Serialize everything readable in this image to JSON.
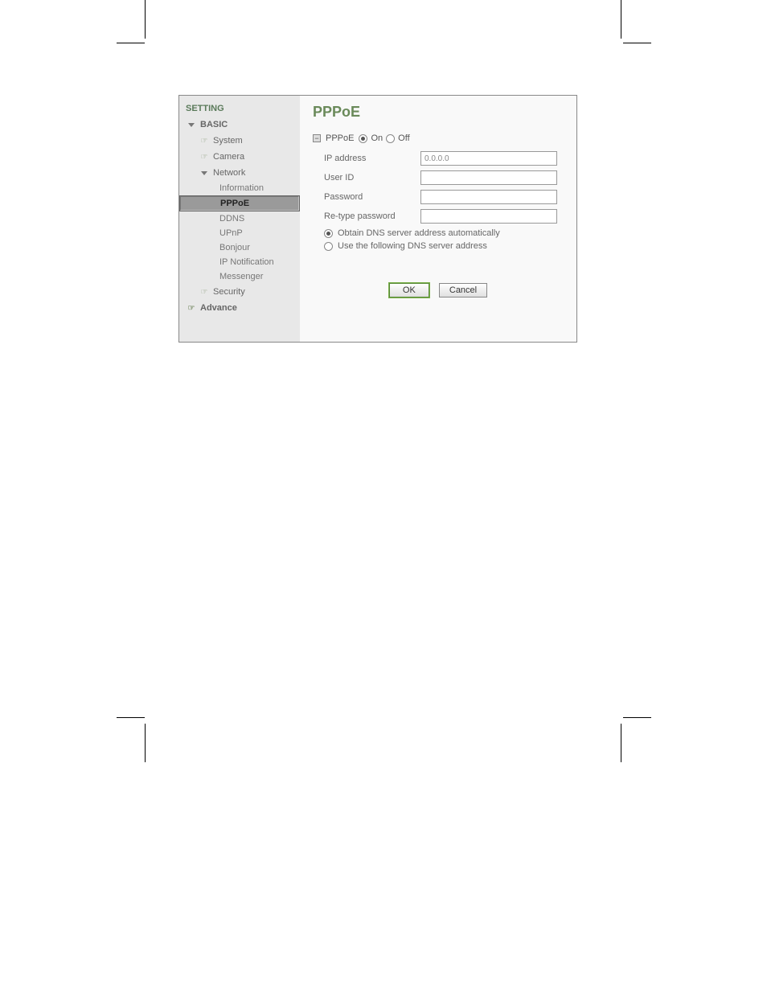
{
  "sidebar": {
    "header": "SETTING",
    "items": [
      {
        "label": "BASIC",
        "level": 1,
        "icon": "arrow-down"
      },
      {
        "label": "System",
        "level": 2,
        "icon": "hand"
      },
      {
        "label": "Camera",
        "level": 2,
        "icon": "hand"
      },
      {
        "label": "Network",
        "level": 2,
        "icon": "arrow-down"
      },
      {
        "label": "Information",
        "level": 3
      },
      {
        "label": "PPPoE",
        "level": 3,
        "selected": true
      },
      {
        "label": "DDNS",
        "level": 3
      },
      {
        "label": "UPnP",
        "level": 3
      },
      {
        "label": "Bonjour",
        "level": 3
      },
      {
        "label": "IP Notification",
        "level": 3
      },
      {
        "label": "Messenger",
        "level": 3
      },
      {
        "label": "Security",
        "level": 2,
        "icon": "hand"
      },
      {
        "label": "Advance",
        "level": 1,
        "icon": "hand"
      }
    ]
  },
  "page": {
    "title": "PPPoE",
    "section_label": "PPPoE",
    "on_label": "On",
    "off_label": "Off",
    "fields": {
      "ip_label": "IP address",
      "ip_value": "0.0.0.0",
      "userid_label": "User ID",
      "userid_value": "",
      "password_label": "Password",
      "password_value": "",
      "retype_label": "Re-type password",
      "retype_value": ""
    },
    "dns_auto_label": "Obtain DNS server address automatically",
    "dns_manual_label": "Use the following DNS server address",
    "buttons": {
      "ok": "OK",
      "cancel": "Cancel"
    }
  }
}
